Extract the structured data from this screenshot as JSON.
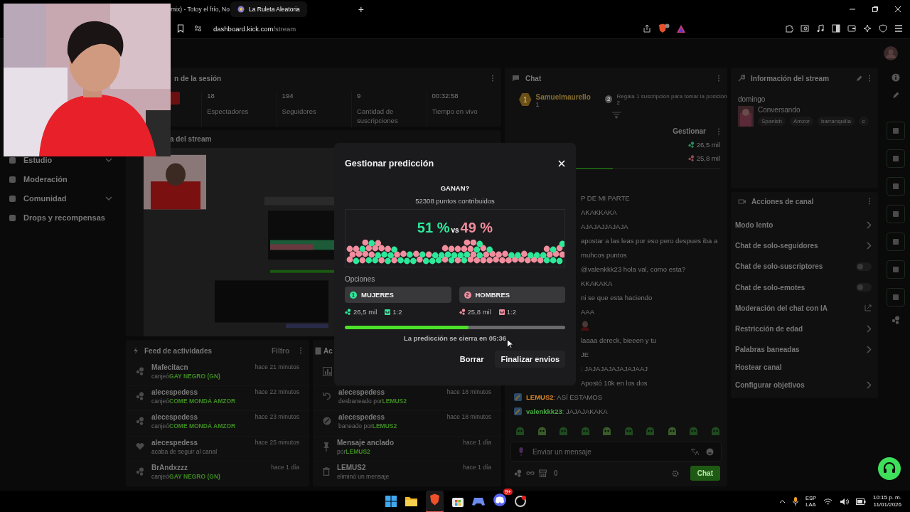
{
  "browser": {
    "tabs": [
      {
        "title": "mix) - Totoy el frío, No",
        "selected": false
      },
      {
        "title": "La Ruleta Aleatoria",
        "selected": true
      }
    ],
    "new_tab": "+",
    "address": {
      "host": "dashboard.kick.com",
      "path": "/stream"
    }
  },
  "sidebar": {
    "items": [
      {
        "label": "Estudio",
        "expandable": true
      },
      {
        "label": "Moderación",
        "expandable": false
      },
      {
        "label": "Comunidad",
        "expandable": true
      },
      {
        "label": "Drops y recompensas",
        "expandable": false
      }
    ]
  },
  "session": {
    "title": "n de la sesión",
    "stats": [
      {
        "value": "18",
        "label": "Espectadores"
      },
      {
        "value": "194",
        "label": "Seguidores"
      },
      {
        "value": "9",
        "label": "Cantidad de suscripciones"
      },
      {
        "value": "00:32:58",
        "label": "Tiempo en vivo"
      }
    ]
  },
  "stream_preview": {
    "title": "a del stream"
  },
  "activity_feed": {
    "title": "Feed de actividades",
    "filter": "Filtro",
    "items": [
      {
        "kind": "redeem",
        "user": "Mafecitacn",
        "action": "canjeó",
        "reward": "GAY NEGRO (GN)",
        "time": "hace 21 minutos"
      },
      {
        "kind": "redeem",
        "user": "alecespedess",
        "action": "canjeó",
        "reward": "COME MONDÁ AMZOR",
        "time": "hace 22 minutos"
      },
      {
        "kind": "redeem",
        "user": "alecespedess",
        "action": "canjeó",
        "reward": "COME MONDÁ AMZOR",
        "time": "hace 23 minutos"
      },
      {
        "kind": "follow",
        "user": "alecespedess",
        "action": "acaba de seguir al canal",
        "time": "hace 25 minutos"
      },
      {
        "kind": "redeem",
        "user": "BrAndxzzz",
        "action": "canjeó",
        "reward": "GAY NEGRO (GN)",
        "time": "hace 1 día"
      }
    ]
  },
  "mod_log": {
    "title": "Ac",
    "items": [
      {
        "kind": "poll"
      },
      {
        "kind": "unban",
        "title": "alecespedess",
        "action": "desbaneado por",
        "actor": "LEMUS2",
        "time": "hace 18 minutos"
      },
      {
        "kind": "ban",
        "title": "alecespedess",
        "action": "baneado por",
        "actor": "LEMUS2",
        "time": "hace 18 minutos"
      },
      {
        "kind": "pin",
        "title": "Mensaje anclado",
        "action": "por",
        "actor": "LEMUS2",
        "time": "hace 1 día"
      },
      {
        "kind": "delete",
        "title": "LEMUS2",
        "action": "eliminó un mensaje",
        "time": "hace 1 día"
      }
    ]
  },
  "chat": {
    "title": "Chat",
    "leader": {
      "rank": "1",
      "name": "Samuelmaurello",
      "count": "1"
    },
    "next": {
      "rank": "2",
      "text": "Regala 1 suscripción para tomar la posición 2"
    },
    "prediction": {
      "manage": "Gestionar",
      "level": 0.5,
      "totals": [
        {
          "value": "26,5 mil",
          "color": "#2a8a5c"
        },
        {
          "value": "25,8 mil",
          "color": "#8a4a55"
        }
      ]
    },
    "messages": [
      {
        "kind": "partial",
        "text": "P DE MI PARTE"
      },
      {
        "kind": "partial",
        "text": "AKAKKAKA"
      },
      {
        "kind": "partial",
        "text": "AJAJAJJAJAJA"
      },
      {
        "kind": "partial",
        "text": "apostar a las leas por eso pero despues iba a"
      },
      {
        "kind": "partial",
        "text": "muhcos puntos"
      },
      {
        "kind": "partial",
        "text": "@valenkkk23 hola val, como esta?"
      },
      {
        "kind": "partial",
        "text": "KKAKAKA"
      },
      {
        "kind": "partial",
        "text": "ni se que esta haciendo"
      },
      {
        "kind": "partial",
        "text": "AAA"
      },
      {
        "kind": "emote"
      },
      {
        "kind": "partial",
        "text": "laaaa dereck, bieeen y tu"
      },
      {
        "kind": "partial",
        "text": "JE"
      },
      {
        "kind": "partial",
        "text": ": JAJAJAJAJAJAJAAJ"
      },
      {
        "kind": "partial",
        "text": "Apostó 10k en los dos"
      },
      {
        "kind": "user",
        "user": "LEMUS2",
        "text": ": ASÍ ESTAMOS",
        "color": "#8a5418"
      },
      {
        "kind": "user",
        "user": "valenkkk23",
        "text": ": JAJAJAKAKA",
        "color": "#2d6a2a"
      }
    ],
    "input": {
      "placeholder": "Enviar un mensaje"
    },
    "store_count": "0",
    "send": "Chat"
  },
  "stream_info": {
    "title": "Información del stream",
    "name": "domingo",
    "category": "Conversando",
    "tags": [
      "Spanish",
      "Amzor",
      "barranquilla",
      "c"
    ]
  },
  "channel_actions": {
    "title": "Acciones de canal",
    "items": [
      {
        "label": "Modo lento",
        "kind": "arrow"
      },
      {
        "label": "Chat de solo-seguidores",
        "kind": "arrow"
      },
      {
        "label": "Chat de solo-suscriptores",
        "kind": "toggle",
        "on": false
      },
      {
        "label": "Chat de solo-emotes",
        "kind": "toggle",
        "on": false
      },
      {
        "label": "Moderación del chat con IA",
        "kind": "external"
      },
      {
        "label": "Restricción de edad",
        "kind": "arrow"
      },
      {
        "label": "Palabras baneadas",
        "kind": "arrow"
      },
      {
        "label": "Hostear canal",
        "kind": "plain"
      },
      {
        "label": "Configurar objetivos",
        "kind": "arrow"
      }
    ]
  },
  "modal": {
    "title": "Gestionar predicción",
    "question": "GANAN?",
    "total": "52308 puntos contribuidos",
    "vs": "vs",
    "options_label": "Opciones",
    "options": [
      {
        "number": "1",
        "label": "MUJERES",
        "percent": "51 %",
        "points": "26,5 mil",
        "ratio": "1:2",
        "color": "#2ee89a"
      },
      {
        "number": "2",
        "label": "HOMBRES",
        "percent": "49 %",
        "points": "25,8 mil",
        "ratio": "1:2",
        "color": "#f28d9e"
      }
    ],
    "progress": {
      "level": 0.56
    },
    "closing": "La predicción se cierra en 05:36",
    "buttons": [
      {
        "label": "Borrar",
        "kind": "text"
      },
      {
        "label": "Finalizar envios",
        "kind": "filled"
      }
    ]
  },
  "taskbar": {
    "badge": "9+",
    "language": "ESP",
    "layout": "LAA",
    "time": "10:15 p. m.",
    "date": "11/01/2026"
  }
}
